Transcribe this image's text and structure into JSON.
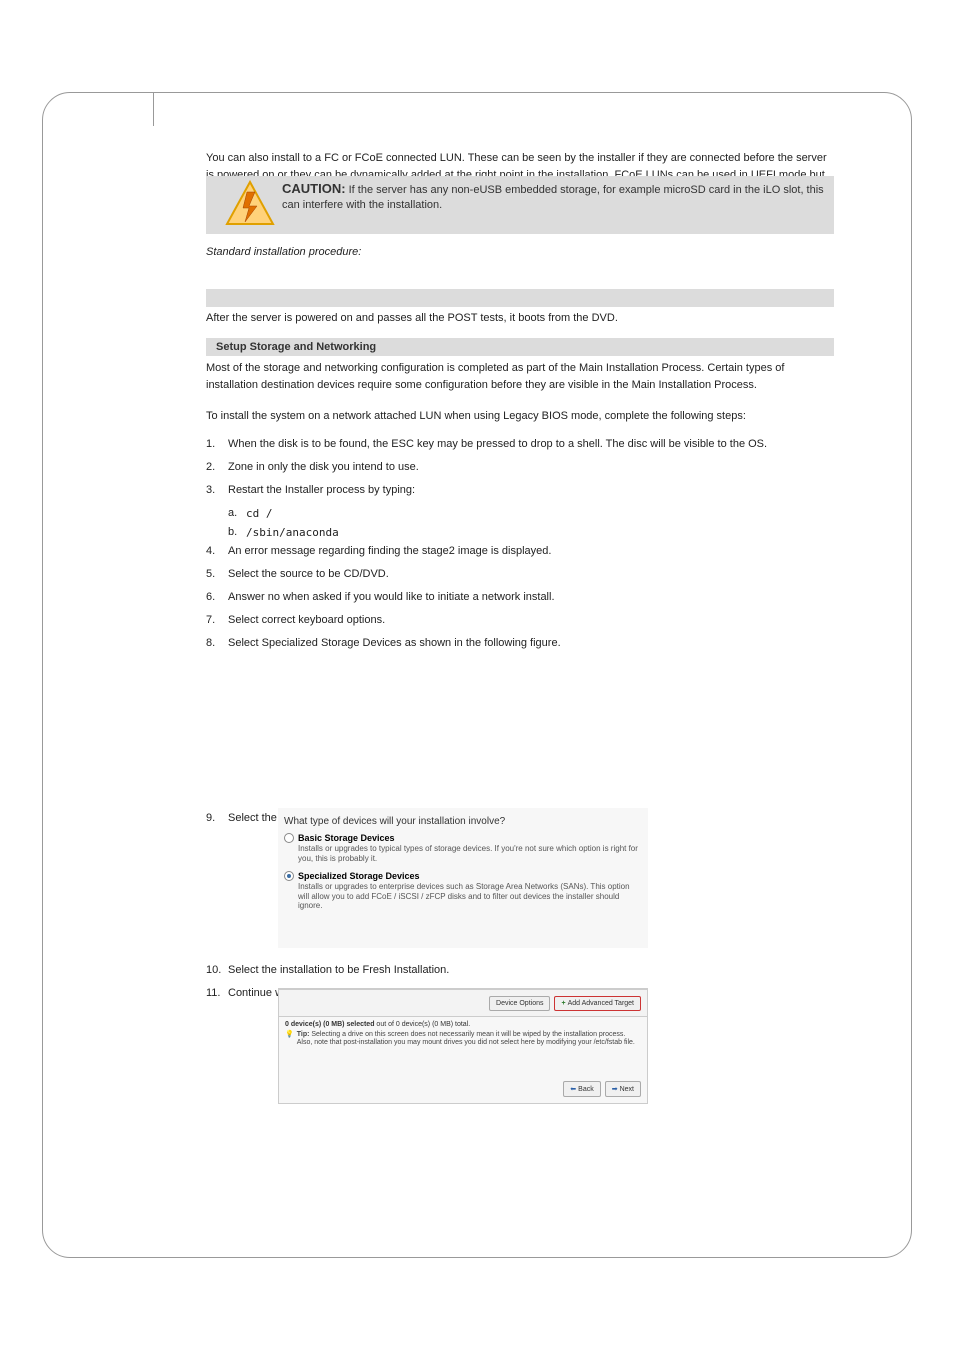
{
  "intro_text": "You can also install to a FC or FCoE connected LUN. These can be seen by the installer if they are connected before the server is powered on or they can be dynamically added at the right point in the installation. FCoE LUNs can be used in UEFI mode but not in BIOS / Legacy mode.",
  "caution": {
    "label": "CAUTION:",
    "text": "If the server has any non-eUSB embedded storage, for example microSD card in the iLO slot, this can interfere with the installation."
  },
  "procedure_title": "Standard installation procedure:",
  "body3": "After the server is powered on and passes all the POST tests, it boots from the DVD.",
  "section2_title": "Setup Storage and Networking",
  "body4": "Most of the storage and networking configuration is completed as part of the Main Installation Process. Certain types of installation destination devices require some configuration before they are visible in the Main Installation Process.",
  "body5": "To install the system on a network attached LUN when using Legacy BIOS mode, complete the following steps:",
  "list": [
    {
      "n": "1.",
      "text": "When the disk is to be found, the ESC key may be pressed to drop to a shell. The disc will be visible to the OS."
    },
    {
      "n": "2.",
      "text": "Zone in only the disk you intend to use."
    },
    {
      "n": "3.",
      "text": "Restart the Installer process by typing:",
      "subs": [
        {
          "k": "a.",
          "t": "cd /"
        },
        {
          "k": "b.",
          "t": "/sbin/anaconda"
        }
      ]
    },
    {
      "n": "4.",
      "text": "An error message regarding finding the stage2 image is displayed."
    },
    {
      "n": "5.",
      "text": "Select the source to be CD/DVD."
    },
    {
      "n": "6.",
      "text": "Answer no when asked if you would like to initiate a network install."
    },
    {
      "n": "7.",
      "text": "Select correct keyboard options."
    },
    {
      "n": "8.",
      "text": "Select Specialized Storage Devices as shown in the following figure."
    },
    {
      "n": "9.",
      "text": "Select the LUN to be used, as shown in the following figure."
    },
    {
      "n": "10.",
      "text": "Select the installation to be Fresh Installation."
    },
    {
      "n": "11.",
      "text": "Continue with the standard installation process."
    }
  ],
  "figure1": {
    "title": "What type of devices will your installation involve?",
    "opt1_title": "Basic Storage Devices",
    "opt1_desc": "Installs or upgrades to typical types of storage devices. If you're not sure which option is right for you, this is probably it.",
    "opt2_title": "Specialized Storage Devices",
    "opt2_desc": "Installs or upgrades to enterprise devices such as Storage Area Networks (SANs). This option will allow you to add FCoE / iSCSI / zFCP disks and to filter out devices the installer should ignore."
  },
  "figure2": {
    "device_options": "Device Options",
    "add_advanced": "Add Advanced Target",
    "selected": "0 device(s) (0 MB) selected",
    "selected_tail": " out of 0 device(s) (0 MB) total.",
    "tip_label": "Tip:",
    "tip_text": " Selecting a drive on this screen does not necessarily mean it will be wiped by the installation process. Also, note that post-installation you may mount drives you did not select here by modifying your /etc/fstab file.",
    "back": "Back",
    "next": "Next"
  },
  "icons": {
    "add": "+",
    "back_arrow": "⬅",
    "next_arrow": "➡",
    "lightbulb": "💡"
  }
}
